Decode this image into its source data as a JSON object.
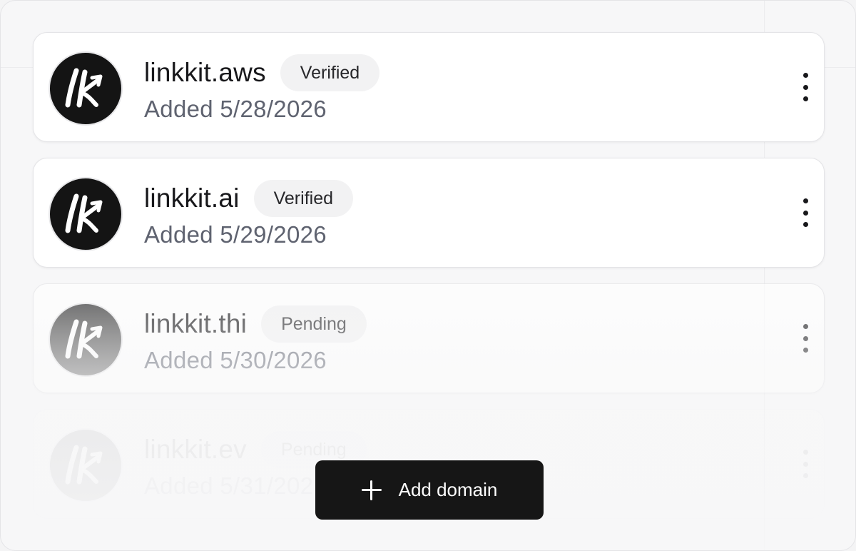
{
  "domains": [
    {
      "name": "linkkit.aws",
      "status": "Verified",
      "added": "Added 5/28/2026"
    },
    {
      "name": "linkkit.ai",
      "status": "Verified",
      "added": "Added 5/29/2026"
    },
    {
      "name": "linkkit.thi",
      "status": "Pending",
      "added": "Added 5/30/2026"
    },
    {
      "name": "linkkit.ev",
      "status": "Pending",
      "added": "Added 5/31/2026"
    }
  ],
  "add_button": {
    "label": "Add domain",
    "icon": "plus-icon"
  },
  "logo": {
    "icon": "linkkit-logo-icon",
    "background": "#141414"
  },
  "colors": {
    "primary": "#161616",
    "badge_bg": "#f2f2f3",
    "muted_text": "#5f6370"
  }
}
